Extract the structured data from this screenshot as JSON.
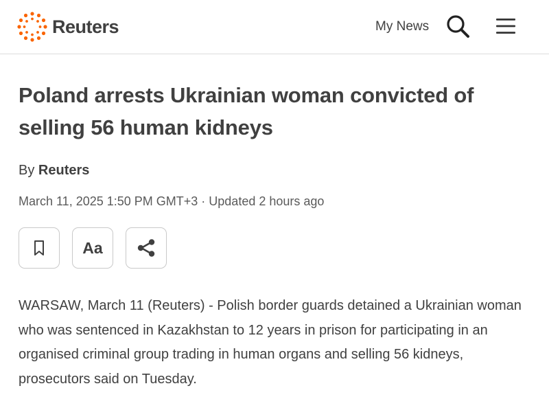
{
  "header": {
    "logo_text": "Reuters",
    "my_news_label": "My News",
    "search_icon": "search-icon",
    "menu_icon": "hamburger-menu-icon",
    "brand_color": "#fa6400"
  },
  "article": {
    "headline": "Poland arrests Ukrainian woman convicted of selling 56 human kidneys",
    "byline_prefix": "By",
    "byline_author": "Reuters",
    "dateline": "March 11, 2025 1:50 PM GMT+3 · Updated 2 hours ago",
    "tools": {
      "bookmark_icon": "bookmark-icon",
      "text_size_label": "Aa",
      "share_icon": "share-icon"
    },
    "body": "WARSAW, March 11 (Reuters) - Polish border guards detained a Ukrainian woman who was sentenced in Kazakhstan to 12 years in prison for participating in an organised criminal group trading in human organs and selling 56 kidneys, prosecutors said on Tuesday."
  }
}
